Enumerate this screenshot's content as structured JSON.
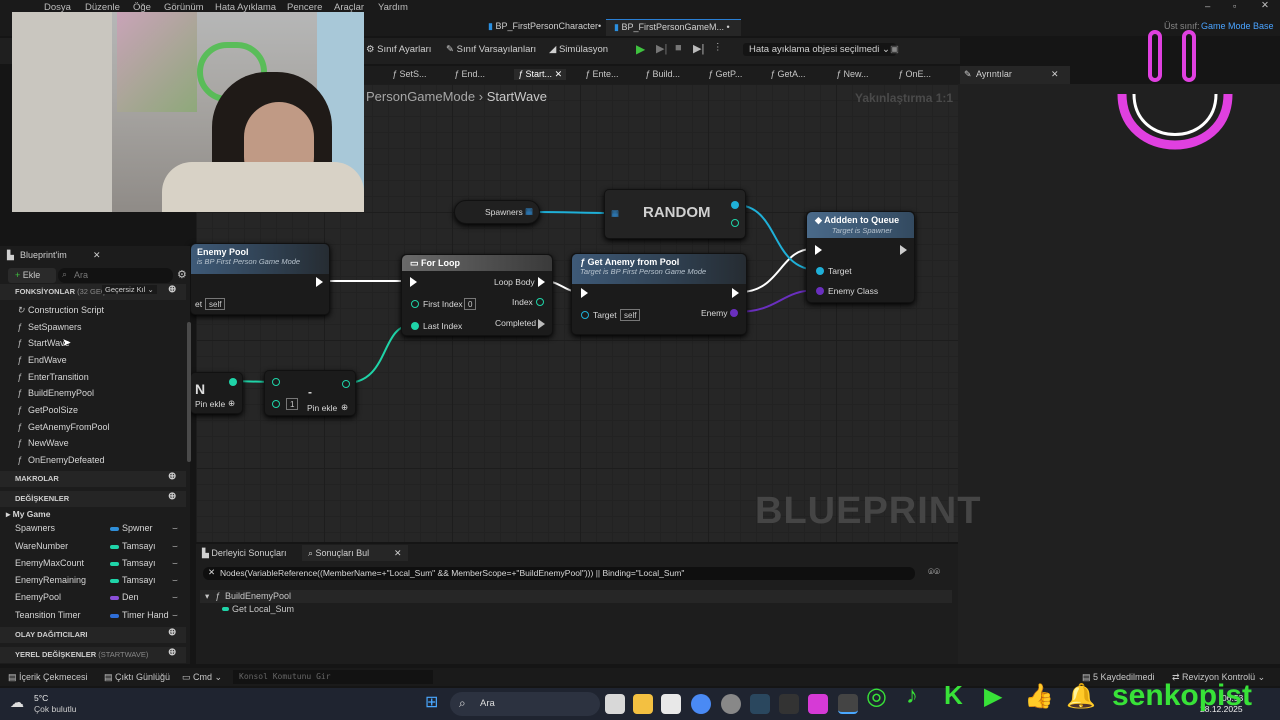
{
  "menubar": {
    "items": [
      "Dosya",
      "Düzenle",
      "Öğe",
      "Görünüm",
      "Hata Ayıklama",
      "Pencere",
      "Araçlar",
      "Yardım"
    ]
  },
  "doc_tabs": [
    {
      "label": "BP_FirstPersonCharacter•",
      "active": false
    },
    {
      "label": "BP_FirstPersonGameM... •",
      "active": true
    }
  ],
  "parent_class": {
    "prefix": "Üst sınıf:",
    "value": "Game Mode Base"
  },
  "toolbar": {
    "class_settings": "Sınıf Ayarları",
    "class_defaults": "Sınıf Varsayılanları",
    "simulation": "Simülasyon",
    "debug_object": "Hata ayıklama objesi seçilmedi"
  },
  "graph_tabs": [
    "SetS...",
    "End...",
    "Start...",
    "Ente...",
    "Build...",
    "GetP...",
    "GetA...",
    "New...",
    "OnE..."
  ],
  "details_tab": "Ayrıntılar",
  "breadcrumb": {
    "parent": "PersonGameMode",
    "separator": "›",
    "current": "StartWave"
  },
  "zoom": "Yakınlaştırma 1:1",
  "watermark": "BLUEPRINT",
  "nodes": {
    "enemy_pool": {
      "title": "Enemy Pool",
      "subtitle": "is BP First Person Game Mode",
      "target_value": "self",
      "pin_prefix": "et"
    },
    "for_loop": {
      "title": "For Loop",
      "loop_body": "Loop Body",
      "first_index": "First Index",
      "first_index_value": "0",
      "index": "Index",
      "last_index": "Last Index",
      "completed": "Completed"
    },
    "spawners": {
      "label": "Spawners"
    },
    "random": {
      "label": "RANDOM"
    },
    "get_enemy_from_pool": {
      "title": "Get Anemy from Pool",
      "subtitle": "Target is BP First Person Game Mode",
      "target": "Target",
      "target_value": "self",
      "enemy": "Enemy"
    },
    "add_to_queue": {
      "title": "Addden to Queue",
      "subtitle": "Target is Spawner",
      "target": "Target",
      "enemy_class": "Enemy Class"
    },
    "add_pin_left": {
      "label": "Pin ekle",
      "partial": "N"
    },
    "subtract": {
      "symbol": "-",
      "value": "1",
      "add_pin": "Pin ekle"
    }
  },
  "blueprint_panel": {
    "tab": "Blueprint'im",
    "add_button": "Ekle",
    "search_placeholder": "Ara",
    "functions_header": "FONKSİYONLAR",
    "functions_override_count": "(32 GEÇE",
    "override_dropdown": "Geçersiz Kıl",
    "functions": [
      "Construction Script",
      "SetSpawners",
      "StartWave",
      "EndWave",
      "EnterTransition",
      "BuildEnemyPool",
      "GetPoolSize",
      "GetAnemyFromPool",
      "NewWave",
      "OnEnemyDefeated"
    ],
    "macros_header": "MAKROLAR",
    "variables_header": "DEĞİŞKENLER",
    "variable_category": "My Game",
    "variables": [
      {
        "name": "Spawners",
        "type": "Spwner",
        "color": "#2f8ed8"
      },
      {
        "name": "WareNumber",
        "type": "Tamsayı",
        "color": "#1fd4a8"
      },
      {
        "name": "EnemyMaxCount",
        "type": "Tamsayı",
        "color": "#1fd4a8"
      },
      {
        "name": "EnemyRemaining",
        "type": "Tamsayı",
        "color": "#1fd4a8"
      },
      {
        "name": "EnemyPool",
        "type": "Den",
        "color": "#8a4fd8"
      },
      {
        "name": "Teansition Timer",
        "type": "Timer Hand",
        "color": "#2f6ed8"
      }
    ],
    "dispatchers_header": "OLAY DAĞITICILARI",
    "locals_header": "YEREL DEĞİŞKENLER",
    "locals_scope": "(STARTWAVE)"
  },
  "bottom_panel": {
    "tabs": [
      "Derleyici Sonuçları",
      "Sonuçları Bul"
    ],
    "search_query": "Nodes(VariableReference((MemberName=+\"Local_Sum\" && MemberScope=+\"BuildEnemyPool\"))) || Binding=\"Local_Sum\"",
    "result_group": "BuildEnemyPool",
    "result_item": "Get Local_Sum"
  },
  "statusbar": {
    "content_drawer": "İçerik Çekmecesi",
    "output_log": "Çıktı Günlüğü",
    "cmd": "Cmd",
    "console_placeholder": "Konsol Komutunu Gir",
    "saved": "5 Kaydedilmedi",
    "revision": "Revizyon Kontrolü"
  },
  "taskbar": {
    "weather_temp": "5°C",
    "weather_desc": "Çok bulutlu",
    "search": "Ara",
    "time": "06:53",
    "date": "28.12.2025"
  },
  "overlay": {
    "channel": "senkopist"
  }
}
